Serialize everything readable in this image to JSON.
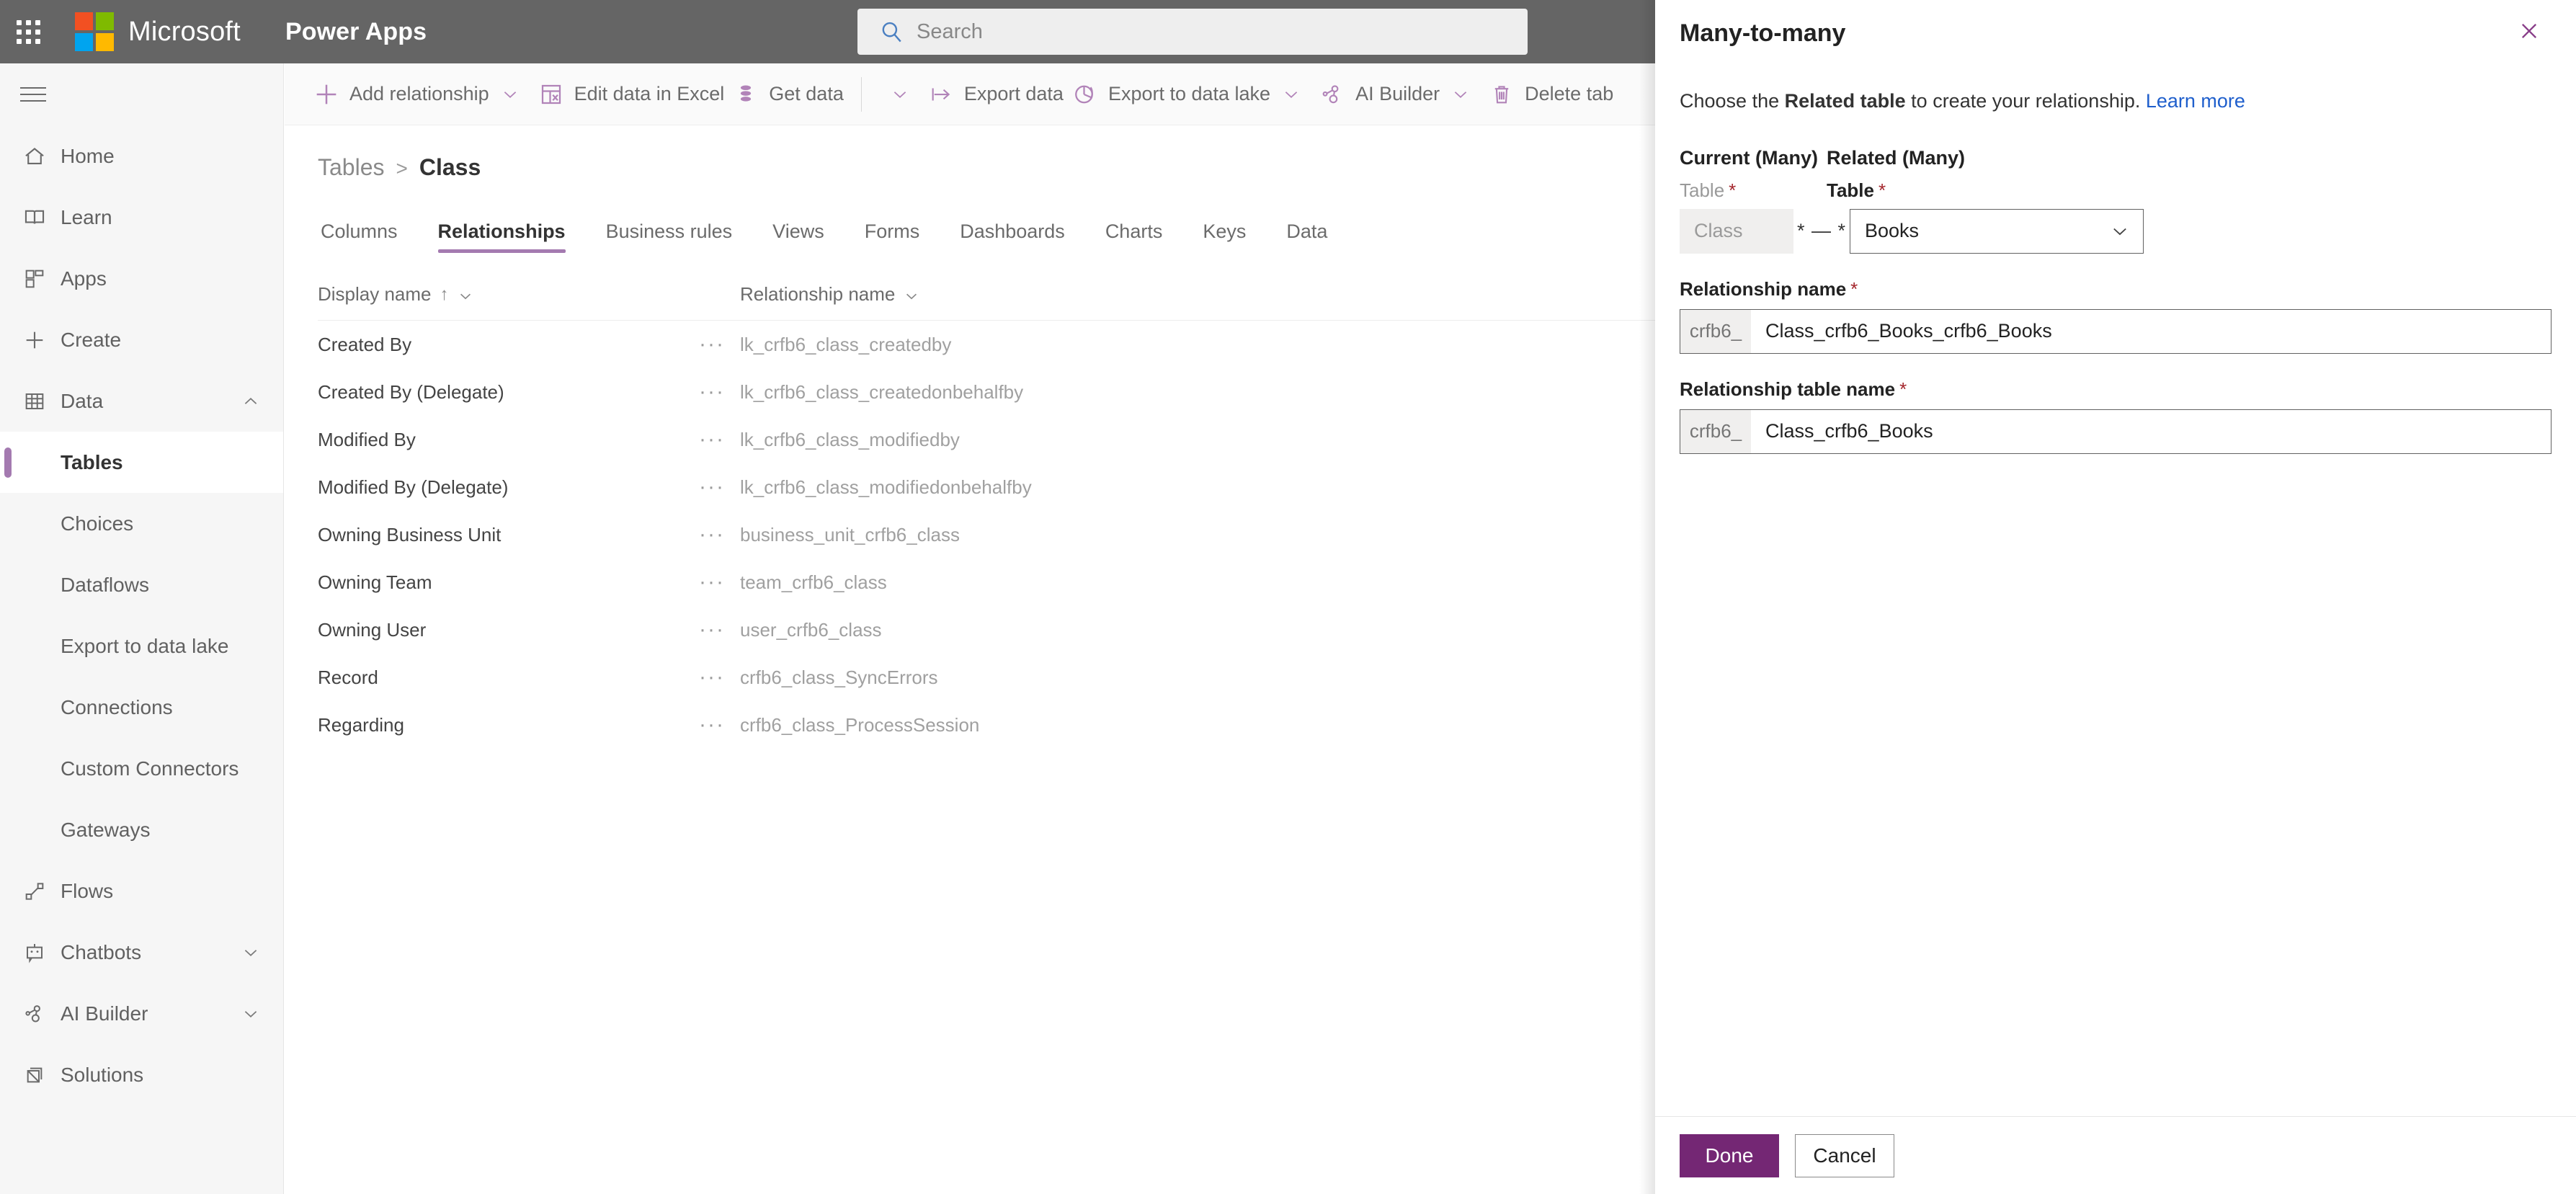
{
  "header": {
    "brand": "Microsoft",
    "app_name": "Power Apps",
    "search_placeholder": "Search",
    "bar_color": "#656565"
  },
  "sidebar": {
    "items": [
      {
        "label": "Home",
        "icon": "home-icon",
        "type": "top",
        "expandable": false
      },
      {
        "label": "Learn",
        "icon": "book-icon",
        "type": "top",
        "expandable": false
      },
      {
        "label": "Apps",
        "icon": "apps-grid-icon",
        "type": "top",
        "expandable": false
      },
      {
        "label": "Create",
        "icon": "plus-icon",
        "type": "top",
        "expandable": false
      },
      {
        "label": "Data",
        "icon": "table-grid-icon",
        "type": "top",
        "expandable": true,
        "expanded": true
      }
    ],
    "data_children": [
      {
        "label": "Tables",
        "selected": true
      },
      {
        "label": "Choices",
        "selected": false
      },
      {
        "label": "Dataflows",
        "selected": false
      },
      {
        "label": "Export to data lake",
        "selected": false
      },
      {
        "label": "Connections",
        "selected": false
      },
      {
        "label": "Custom Connectors",
        "selected": false
      },
      {
        "label": "Gateways",
        "selected": false
      }
    ],
    "bottom_items": [
      {
        "label": "Flows",
        "icon": "flow-icon",
        "expandable": false
      },
      {
        "label": "Chatbots",
        "icon": "chatbot-icon",
        "expandable": true
      },
      {
        "label": "AI Builder",
        "icon": "ai-builder-icon",
        "expandable": true
      },
      {
        "label": "Solutions",
        "icon": "solutions-icon",
        "expandable": false
      }
    ],
    "accent_color": "#a47ab0"
  },
  "commandbar": {
    "items": [
      {
        "label": "Add relationship",
        "icon": "plus-icon",
        "chevron": true,
        "sep_after": false
      },
      {
        "label": "Edit data in Excel",
        "icon": "excel-icon",
        "chevron": false,
        "sep_after": false
      },
      {
        "label": "Get data",
        "icon": "get-data-icon",
        "chevron": true,
        "sep_after": true
      },
      {
        "label": "Export data",
        "icon": "export-icon",
        "chevron": false,
        "sep_after": false
      },
      {
        "label": "Export to data lake",
        "icon": "data-lake-icon",
        "chevron": true,
        "sep_after": false
      },
      {
        "label": "AI Builder",
        "icon": "ai-builder-icon",
        "chevron": true,
        "sep_after": false
      },
      {
        "label": "Delete tab",
        "icon": "trash-icon",
        "chevron": false,
        "sep_after": false
      }
    ],
    "icon_color": "#b183b8"
  },
  "breadcrumb": {
    "parent": "Tables",
    "separator": ">",
    "current": "Class"
  },
  "tabs": [
    {
      "label": "Columns",
      "active": false
    },
    {
      "label": "Relationships",
      "active": true
    },
    {
      "label": "Business rules",
      "active": false
    },
    {
      "label": "Views",
      "active": false
    },
    {
      "label": "Forms",
      "active": false
    },
    {
      "label": "Dashboards",
      "active": false
    },
    {
      "label": "Charts",
      "active": false
    },
    {
      "label": "Keys",
      "active": false
    },
    {
      "label": "Data",
      "active": false
    }
  ],
  "table": {
    "columns": [
      {
        "label": "Display name",
        "sort": "asc",
        "sort_glyph": "↑"
      },
      {
        "label": "Relationship name",
        "sort": "none",
        "sort_glyph": ""
      }
    ],
    "row_menu_glyph": "···",
    "rows": [
      {
        "display_name": "Created By",
        "relationship_name": "lk_crfb6_class_createdby"
      },
      {
        "display_name": "Created By (Delegate)",
        "relationship_name": "lk_crfb6_class_createdonbehalfby"
      },
      {
        "display_name": "Modified By",
        "relationship_name": "lk_crfb6_class_modifiedby"
      },
      {
        "display_name": "Modified By (Delegate)",
        "relationship_name": "lk_crfb6_class_modifiedonbehalfby"
      },
      {
        "display_name": "Owning Business Unit",
        "relationship_name": "business_unit_crfb6_class"
      },
      {
        "display_name": "Owning Team",
        "relationship_name": "team_crfb6_class"
      },
      {
        "display_name": "Owning User",
        "relationship_name": "user_crfb6_class"
      },
      {
        "display_name": "Record",
        "relationship_name": "crfb6_class_SyncErrors"
      },
      {
        "display_name": "Regarding",
        "relationship_name": "crfb6_class_ProcessSession"
      }
    ]
  },
  "panel": {
    "title": "Many-to-many",
    "close_label": "Close",
    "description_prefix": "Choose the ",
    "description_bold": "Related table",
    "description_suffix": " to create your relationship. ",
    "learn_more": "Learn more",
    "learn_more_color": "#1f5fcc",
    "current_section": {
      "heading": "Current (Many)",
      "field_label": "Table",
      "required_marker": "*",
      "value": "Class",
      "disabled": true
    },
    "cardinality_glyph": "* — *",
    "related_section": {
      "heading": "Related (Many)",
      "field_label": "Table",
      "required_marker": "*",
      "value": "Books",
      "disabled": false
    },
    "relationship_name": {
      "label": "Relationship name",
      "required_marker": "*",
      "prefix": "crfb6_",
      "value": "Class_crfb6_Books_crfb6_Books"
    },
    "relationship_table_name": {
      "label": "Relationship table name",
      "required_marker": "*",
      "prefix": "crfb6_",
      "value": "Class_crfb6_Books"
    },
    "footer": {
      "primary": "Done",
      "secondary": "Cancel",
      "primary_color": "#742774"
    }
  }
}
